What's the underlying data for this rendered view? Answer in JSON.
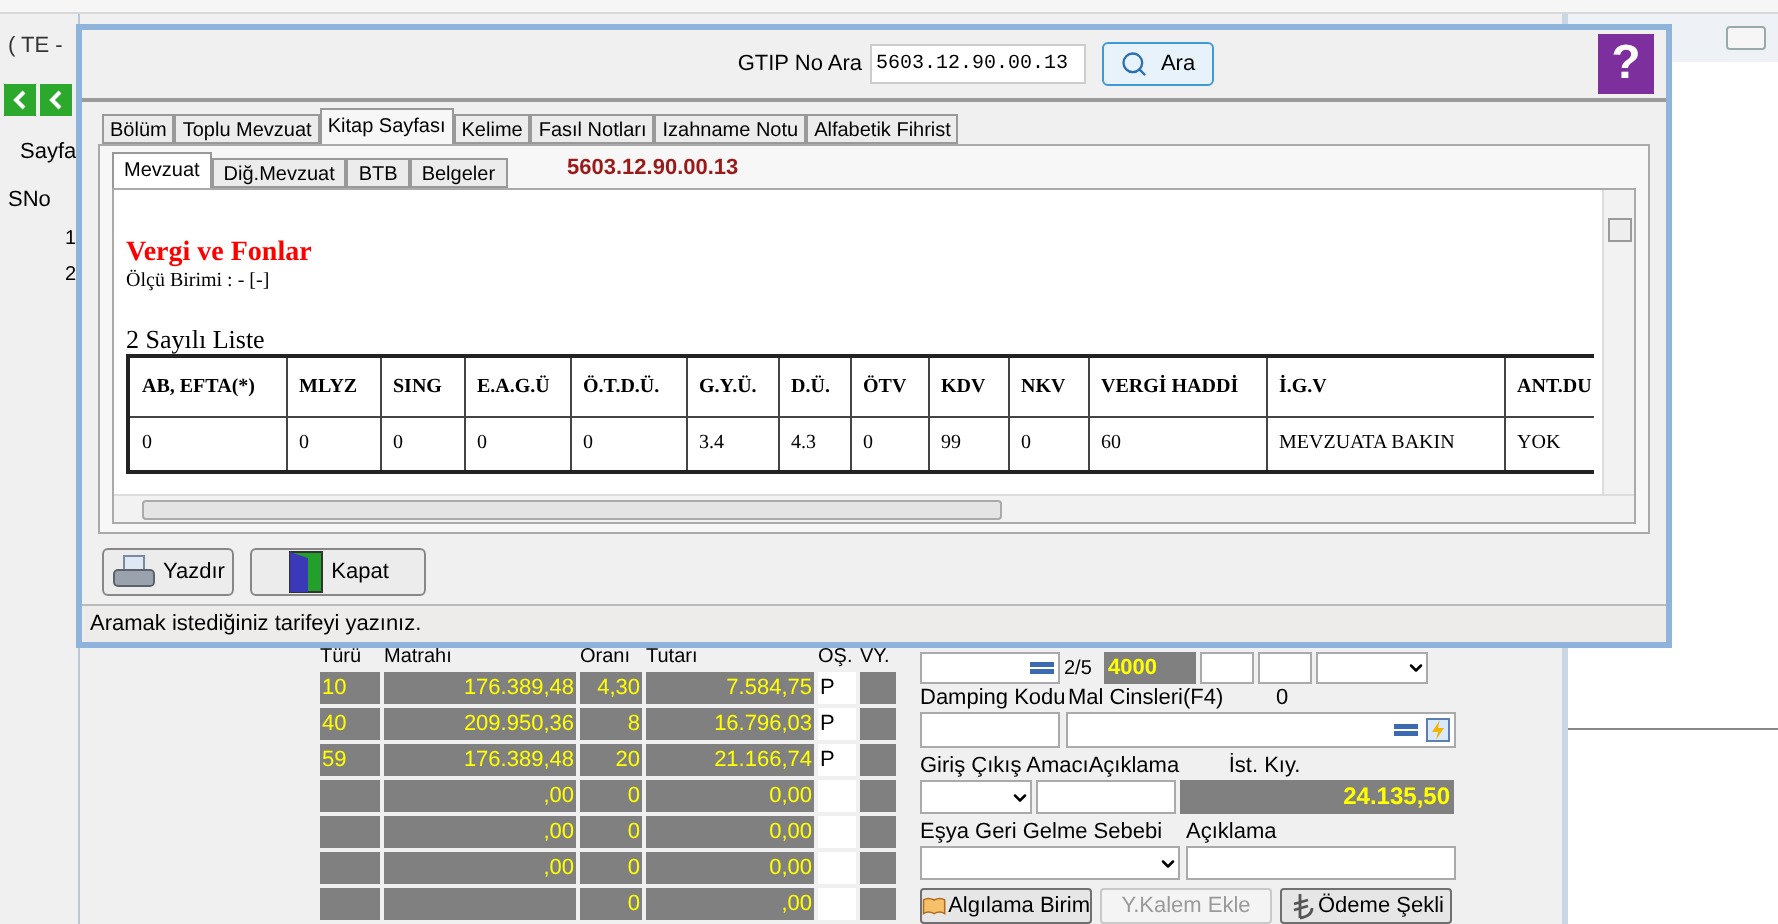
{
  "background_app": {
    "title_fragment": "( TE -",
    "left_list": {
      "header": "Sayfa",
      "column": "SNo",
      "rows": [
        "1",
        "2"
      ]
    },
    "tax_table": {
      "columns": [
        "Türü",
        "Matrahı",
        "Oranı",
        "Tutarı",
        "ÖŞ.",
        "VY."
      ],
      "rows": [
        {
          "type": "10",
          "base": "176.389,48",
          "rate": "4,30",
          "amount": "7.584,75",
          "os": "P"
        },
        {
          "type": "40",
          "base": "209.950,36",
          "rate": "8",
          "amount": "16.796,03",
          "os": "P"
        },
        {
          "type": "59",
          "base": "176.389,48",
          "rate": "20",
          "amount": "21.166,74",
          "os": "P"
        },
        {
          "type": "",
          "base": ",00",
          "rate": "0",
          "amount": "0,00",
          "os": ""
        },
        {
          "type": "",
          "base": ",00",
          "rate": "0",
          "amount": "0,00",
          "os": ""
        },
        {
          "type": "",
          "base": ",00",
          "rate": "0",
          "amount": "0,00",
          "os": ""
        },
        {
          "type": "",
          "base": "",
          "rate": "0",
          "amount": ",00",
          "os": ""
        }
      ]
    },
    "form": {
      "page_indicator": "2/5",
      "code_value": "4000",
      "damping_label": "Damping Kodu",
      "goods_label": "Mal Cinsleri(F4)",
      "goods_count": "0",
      "purpose_label": "Giriş Çıkış Amacı",
      "purpose_note_label": "Açıklama",
      "stat_value_label": "İst. Kıy.",
      "stat_value": "24.135,50",
      "return_reason_label": "Eşya Geri Gelme Sebebi",
      "return_note_label": "Açıklama",
      "buttons": [
        {
          "label": "Algılama Birim",
          "disabled": false,
          "kind": "book"
        },
        {
          "label": "Y.Kalem Ekle",
          "disabled": true,
          "kind": "plain"
        },
        {
          "label": "Ödeme Şekli",
          "disabled": false,
          "kind": "money"
        }
      ]
    }
  },
  "dialog": {
    "search_label": "GTIP No Ara",
    "search_value": "5603.12.90.00.13",
    "search_button": "Ara",
    "help_label": "?",
    "tabs": [
      {
        "label": "Bölüm",
        "selected": false
      },
      {
        "label": "Toplu Mevzuat",
        "selected": false
      },
      {
        "label": "Kitap Sayfası",
        "selected": true
      },
      {
        "label": "Kelime",
        "selected": false
      },
      {
        "label": "Fasıl Notları",
        "selected": false
      },
      {
        "label": "Izahname Notu",
        "selected": false
      },
      {
        "label": "Alfabetik Fihrist",
        "selected": false
      }
    ],
    "subtabs": [
      {
        "label": "Mevzuat",
        "selected": true
      },
      {
        "label": "Diğ.Mevzuat",
        "selected": false
      },
      {
        "label": "BTB",
        "selected": false
      },
      {
        "label": "Belgeler",
        "selected": false
      }
    ],
    "code": "5603.12.90.00.13",
    "section_title": "Vergi ve Fonlar",
    "unit_line": "Ölçü Birimi : - [-]",
    "list_title": "2 Sayılı Liste",
    "table": {
      "columns": [
        "AB, EFTA(*)",
        "MLYZ",
        "SING",
        "E.A.G.Ü",
        "Ö.T.D.Ü.",
        "G.Y.Ü.",
        "D.Ü.",
        "ÖTV",
        "KDV",
        "NKV",
        "VERGİ HADDİ",
        "İ.G.V",
        "ANT.DU"
      ],
      "rows": [
        [
          "0",
          "0",
          "0",
          "0",
          "0",
          "3.4",
          "4.3",
          "0",
          "99",
          "0",
          "60",
          "MEVZUATA BAKIN",
          "YOK"
        ]
      ]
    },
    "buttons": [
      {
        "label": "Yazdır",
        "kind": "print"
      },
      {
        "label": "Kapat",
        "kind": "exit"
      }
    ],
    "status": "Aramak istediğiniz tarifeyi yazınız."
  }
}
